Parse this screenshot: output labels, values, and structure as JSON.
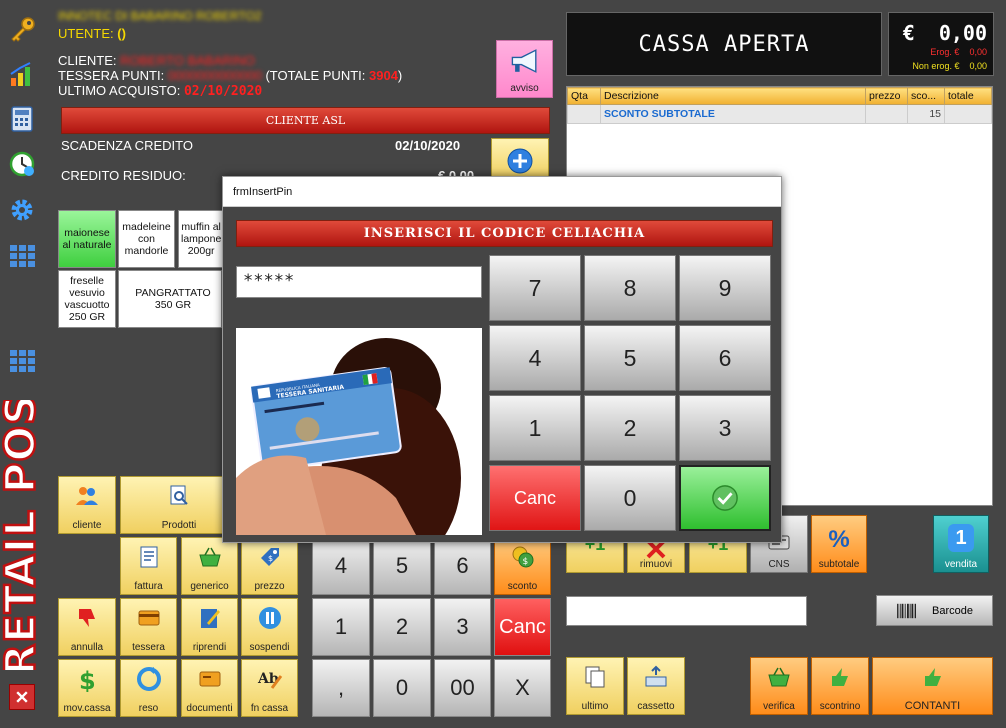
{
  "customer": {
    "company": "INNOTEC DI BABARINO ROBERTO2",
    "utente_label": "UTENTE:",
    "utente_value": "()",
    "cliente_label": "CLIENTE:",
    "cliente_value": "ROBERTO BABARINO",
    "tessera_label": "TESSERA PUNTI:",
    "tessera_value": "0000000000000",
    "totale_label": "(TOTALE PUNTI:",
    "totale_value": "3904",
    "totale_close": ")",
    "ultimo_label": "ULTIMO ACQUISTO:",
    "ultimo_value": "02/10/2020",
    "avviso": "avviso",
    "asl": "CLIENTE ASL",
    "scadenza_label": "SCADENZA CREDITO",
    "scadenza_value": "02/10/2020",
    "credito_label": "CREDITO RESIDUO:",
    "credito_value": "€ 0,00"
  },
  "products": [
    "maionese al naturale",
    "madeleine con mandorle",
    "muffin al lampone 200gr",
    "freselle vesuvio vascuotto 250 GR",
    "PANGRATTATO 350 GR"
  ],
  "cassa": {
    "status": "CASSA APERTA",
    "currency": "€",
    "amount": "0,00",
    "erog_label": "Erog. €",
    "erog_value": "0,00",
    "nonerog_label": "Non erog. €",
    "nonerog_value": "0,00"
  },
  "grid": {
    "headers": [
      "Qta",
      "Descrizione",
      "prezzo",
      "sco...",
      "totale"
    ],
    "row": {
      "qta": "",
      "descr": "SCONTO SUBTOTALE",
      "prezzo": "",
      "sconto": "15",
      "totale": ""
    }
  },
  "left_buttons": {
    "cliente": "cliente",
    "prodotti": "Prodotti",
    "fattura": "fattura",
    "generico": "generico",
    "prezzo": "prezzo",
    "sconto": "sconto",
    "annulla": "annulla",
    "tessera": "tessera",
    "riprendi": "riprendi",
    "sospendi": "sospendi",
    "movcassa": "mov.cassa",
    "reso": "reso",
    "documenti": "documenti",
    "fncassa": "fn cassa"
  },
  "numpad": {
    "k4": "4",
    "k5": "5",
    "k6": "6",
    "k1": "1",
    "k2": "2",
    "k3": "3",
    "canc": "Canc",
    "comma": ",",
    "k0": "0",
    "k00": "00",
    "x": "X"
  },
  "right_buttons": {
    "rimuovi": "rimuovi",
    "cns": "CNS",
    "subtotale": "subtotale",
    "vendita": "vendita",
    "vendita_num": "1",
    "barcode": "Barcode",
    "ultimo": "ultimo",
    "cassetto": "cassetto",
    "verifica": "verifica",
    "scontrino": "scontrino",
    "contanti": "CONTANTI"
  },
  "modal": {
    "title": "frmInsertPin",
    "header": "INSERISCI IL CODICE CELIACHIA",
    "pin": "*****",
    "keys": [
      "7",
      "8",
      "9",
      "4",
      "5",
      "6",
      "1",
      "2",
      "3"
    ],
    "canc": "Canc",
    "zero": "0",
    "card_line1": "TESSERA SANITARIA",
    "card_line2": "REPUBBLICA ITALIANA"
  },
  "brand": "RETAIL POS"
}
